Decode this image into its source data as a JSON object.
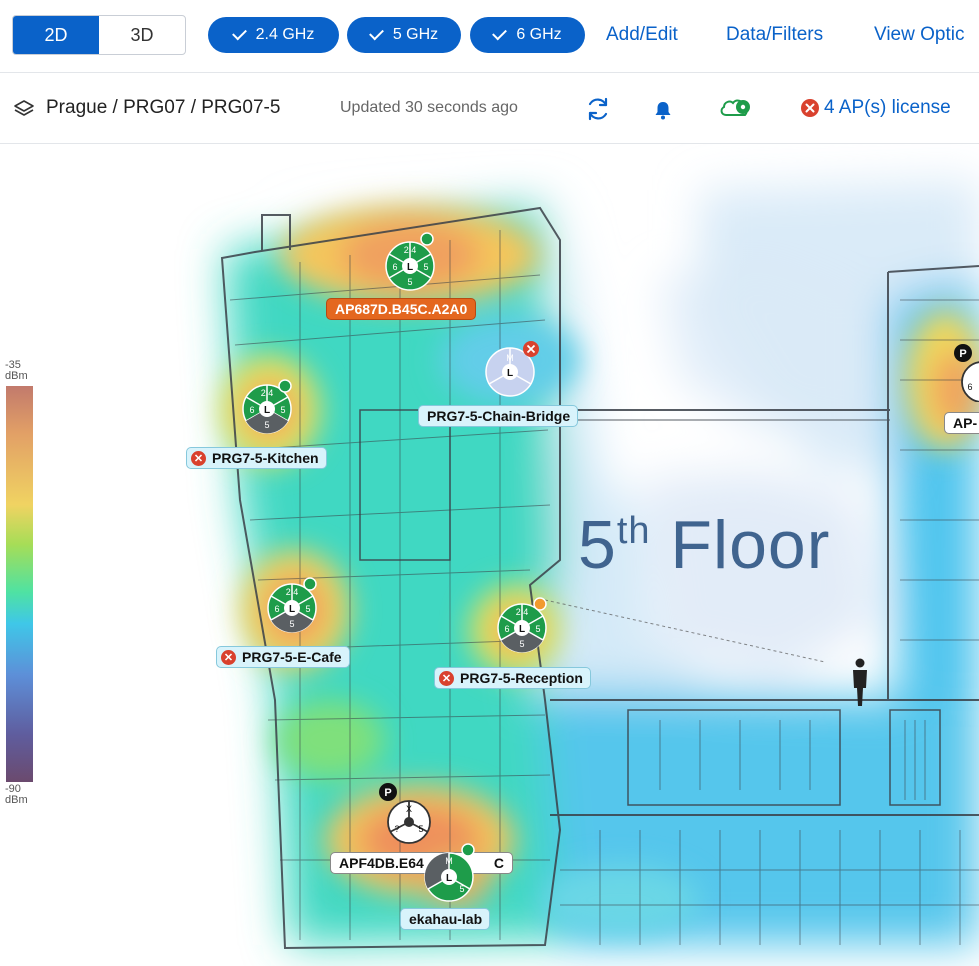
{
  "toolbar": {
    "view_2d": "2D",
    "view_3d": "3D",
    "band_24": "2.4 GHz",
    "band_5": "5 GHz",
    "band_6": "6 GHz",
    "add_edit": "Add/Edit",
    "data_filters": "Data/Filters",
    "view_options": "View Optic"
  },
  "breadcrumb": {
    "path": "Prague / PRG07 / PRG07-5",
    "updated": "Updated 30 seconds ago",
    "license_alert": "4 AP(s) license"
  },
  "legend": {
    "top_value": "-35",
    "top_unit": "dBm",
    "bottom_value": "-90",
    "bottom_unit": "dBm"
  },
  "map": {
    "floor_label": "5",
    "floor_label_sup": "th",
    "floor_label_rest": " Floor"
  },
  "access_points": [
    {
      "name": "AP687D.B45C.A2A0",
      "status": "ok",
      "bands": [
        "2.4",
        "6",
        "5",
        "5"
      ],
      "center": "L"
    },
    {
      "name": "PRG7-5-Chain-Bridge",
      "status": "error",
      "bands": [
        "M",
        "",
        ""
      ],
      "center": "L"
    },
    {
      "name": "PRG7-5-Kitchen",
      "status": "error",
      "bands": [
        "2.4",
        "6",
        "5",
        "5"
      ],
      "center": "L"
    },
    {
      "name": "PRG7-5-E-Cafe",
      "status": "error",
      "bands": [
        "2.4",
        "6",
        "5",
        "5"
      ],
      "center": "L"
    },
    {
      "name": "PRG7-5-Reception",
      "status": "error",
      "bands": [
        "2.4",
        "6",
        "5",
        "5"
      ],
      "center": "L"
    },
    {
      "name": "APF4DB.E64",
      "name_suffix": "C",
      "status": "planned",
      "bands": [
        "X",
        "?",
        "5"
      ],
      "badge": "P"
    },
    {
      "name": "ekahau-lab",
      "status": "ok",
      "bands": [
        "M",
        "L",
        "5"
      ],
      "center": "L"
    },
    {
      "name": "AP-",
      "status": "planned",
      "badge": "P",
      "band_partial": "6"
    }
  ],
  "colors": {
    "accent": "#0a62c9",
    "ap_green": "#1e9c4a",
    "error_red": "#d9412e",
    "label_bg": "#d8f3fb",
    "label_orange": "#e4671f"
  }
}
